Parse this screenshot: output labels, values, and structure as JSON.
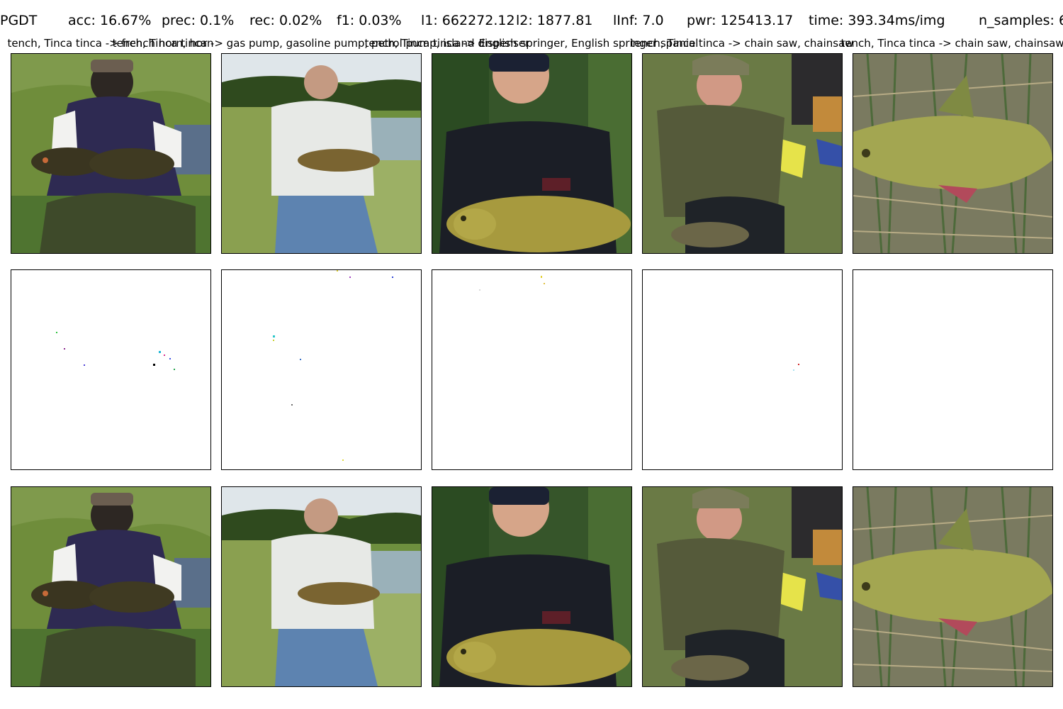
{
  "metrics": {
    "attack": "PGDT",
    "acc": "acc: 16.67%",
    "prec": "prec: 0.1%",
    "rec": "rec: 0.02%",
    "f1": "f1: 0.03%",
    "l1": "l1: 662272.12",
    "l2": "l2: 1877.81",
    "linf": "lInf: 7.0",
    "pwr": "pwr: 125413.17",
    "time": "time: 393.34ms/img",
    "n_samples": "n_samples: 6"
  },
  "tile_labels": [
    "tench, Tinca tinca -> french horn, horn",
    "tench, Tinca tinca -> gas pump, gasoline pump, petrol pump, island dispenser",
    "tench, Tinca tinca -> English springer, English springer spaniel",
    "tench, Tinca tinca -> chain saw, chainsaw",
    "tench, Tinca tinca -> chain saw, chainsaw"
  ],
  "rows": [
    {
      "role": "original images"
    },
    {
      "role": "perturbation"
    },
    {
      "role": "adversarial images"
    }
  ],
  "scene_names": [
    "angler-purple-jacket-holding-tench",
    "angler-white-polo-holding-tench-by-lake",
    "angler-black-shirt-cap-holding-tench",
    "angler-green-jacket-crouching-with-tench",
    "tench-lying-on-reeds"
  ],
  "colors": {
    "background": "#ffffff",
    "border": "#000000"
  }
}
